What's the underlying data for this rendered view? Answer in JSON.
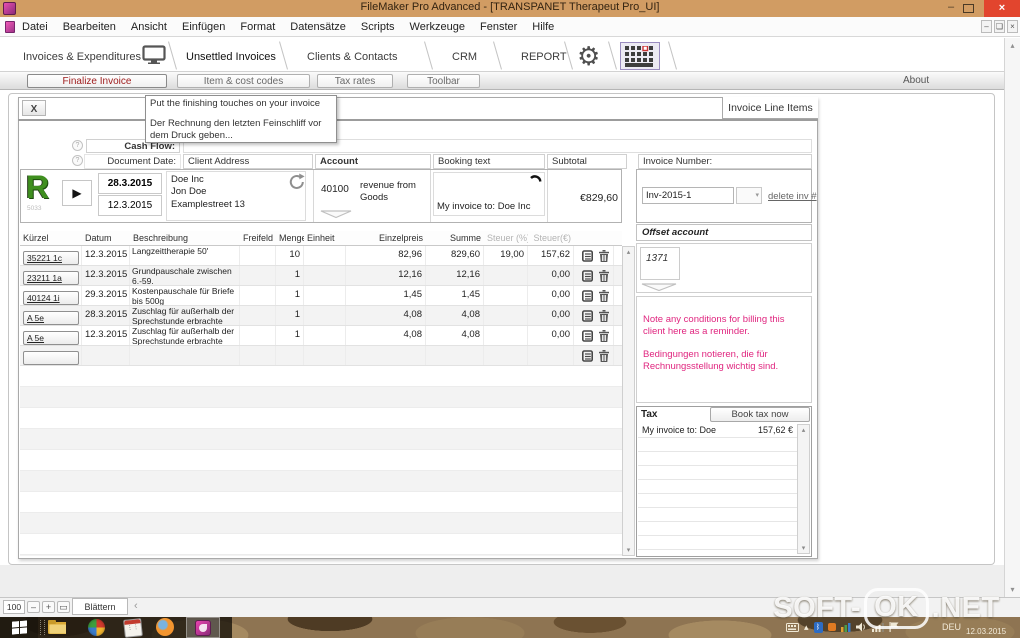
{
  "window": {
    "title": "FileMaker Pro Advanced - [TRANSPANET Therapeut Pro_UI]"
  },
  "menubar": {
    "items": [
      "Datei",
      "Bearbeiten",
      "Ansicht",
      "Einfügen",
      "Format",
      "Datensätze",
      "Scripts",
      "Werkzeuge",
      "Fenster",
      "Hilfe"
    ]
  },
  "tabs": {
    "items": [
      "Invoices & Expenditures",
      "Unsettled Invoices",
      "Clients & Contacts",
      "CRM",
      "REPORT"
    ],
    "active_index": 1
  },
  "subtabs": {
    "buttons": [
      "Finalize Invoice",
      "Item & cost codes",
      "Tax rates",
      "Toolbar"
    ],
    "active_index": 0,
    "about_label": "About"
  },
  "tooltip": {
    "line_en": "Put the finishing touches on your invoice",
    "line_de": "Der Rechnung den letzten Feinschliff vor dem Druck geben..."
  },
  "panel": {
    "close_label": "X",
    "title": "Invoice Line Items"
  },
  "header_labels": {
    "cash_flow": "Cash Flow:",
    "document_date": "Document Date:",
    "client_address": "Client Address",
    "account": "Account",
    "booking_text": "Booking text",
    "subtotal": "Subtotal",
    "invoice_number": "Invoice Number:"
  },
  "record": {
    "record_letter": "R",
    "record_id": "5033",
    "date_top": "28.3.2015",
    "date_bottom": "12.3.2015",
    "address": [
      "Doe Inc",
      "Jon Doe",
      "Examplestreet 13"
    ],
    "account_code": "40100",
    "account_name": "revenue from Goods",
    "booking_text": "My invoice to: Doe Inc",
    "subtotal_value": "€829,60",
    "invoice_number": "Inv-2015-1",
    "delete_link": "delete inv #"
  },
  "table": {
    "columns": [
      "Kürzel",
      "Datum",
      "Beschreibung",
      "Freifeld",
      "Menge",
      "Einheit",
      "Einzelpreis",
      "Summe",
      "Steuer (%)",
      "Steuer(€)"
    ],
    "rows": [
      {
        "kuerzel": "35221 1c",
        "datum": "12.3.2015",
        "beschreibung": "Langzeittherapie 50'",
        "freifeld": "",
        "menge": "10",
        "einheit": "",
        "einzelpreis": "82,96",
        "summe": "829,60",
        "steuer_pct": "19,00",
        "steuer_eur": "157,62",
        "focused": false,
        "empty": false
      },
      {
        "kuerzel": "23211 1a",
        "datum": "12.3.2015",
        "beschreibung": "Grundpauschale zwischen 6.-59.",
        "freifeld": "",
        "menge": "1",
        "einheit": "",
        "einzelpreis": "12,16",
        "summe": "12,16",
        "steuer_pct": "",
        "steuer_eur": "0,00",
        "focused": false,
        "empty": false
      },
      {
        "kuerzel": "40124 1i",
        "datum": "29.3.2015",
        "beschreibung": "Kostenpauschale für Briefe bis 500g",
        "freifeld": "",
        "menge": "1",
        "einheit": "",
        "einzelpreis": "1,45",
        "summe": "1,45",
        "steuer_pct": "",
        "steuer_eur": "0,00",
        "focused": true,
        "empty": false
      },
      {
        "kuerzel": "A 5e",
        "datum": "28.3.2015",
        "beschreibung": "Zuschlag für außerhalb der Sprechstunde erbrachte",
        "freifeld": "",
        "menge": "1",
        "einheit": "",
        "einzelpreis": "4,08",
        "summe": "4,08",
        "steuer_pct": "",
        "steuer_eur": "0,00",
        "focused": false,
        "empty": false
      },
      {
        "kuerzel": "A 5e",
        "datum": "12.3.2015",
        "beschreibung": "Zuschlag für außerhalb der Sprechstunde erbrachte",
        "freifeld": "",
        "menge": "1",
        "einheit": "",
        "einzelpreis": "4,08",
        "summe": "4,08",
        "steuer_pct": "",
        "steuer_eur": "0,00",
        "focused": false,
        "empty": false
      },
      {
        "kuerzel": "",
        "datum": "",
        "beschreibung": "",
        "freifeld": "",
        "menge": "",
        "einheit": "",
        "einzelpreis": "",
        "summe": "",
        "steuer_pct": "",
        "steuer_eur": "",
        "focused": false,
        "empty": true
      }
    ],
    "filler_row_count": 10
  },
  "offset": {
    "title": "Offset account",
    "account": "1371"
  },
  "notes": {
    "line_en": "Note any conditions for billing this client here as a reminder.",
    "line_de": "Bedingungen notieren, die für Rechnungsstellung wichtig sind."
  },
  "tax": {
    "label": "Tax",
    "button_label": "Book tax now",
    "rows": [
      {
        "label": "My invoice to: Doe",
        "value": "157,62 €"
      }
    ],
    "empty_row_count": 9
  },
  "statusbar": {
    "zoom_level": "100",
    "mode": "Blättern"
  },
  "taskbar": {
    "tray_language": "DEU",
    "tray_date": "12.03.2015"
  },
  "watermark": {
    "left": "SOFT-",
    "boxed": "OK",
    "right": ".NET"
  },
  "icons": {
    "close": "×",
    "minimize": "–",
    "dropdown": "▾",
    "play": "▶",
    "scroll_up": "▴",
    "scroll_down": "▾",
    "collapse_left": "‹",
    "question": "?",
    "minus": "–",
    "plus": "+"
  },
  "colors": {
    "titlebar": "#d19c63",
    "close_button": "#e2452e",
    "note_pink": "#e0257f",
    "active_tab_red": "#9e1b1b",
    "record_green": "#3f8f1f",
    "filemaker_magenta": "#cc2a9a"
  }
}
